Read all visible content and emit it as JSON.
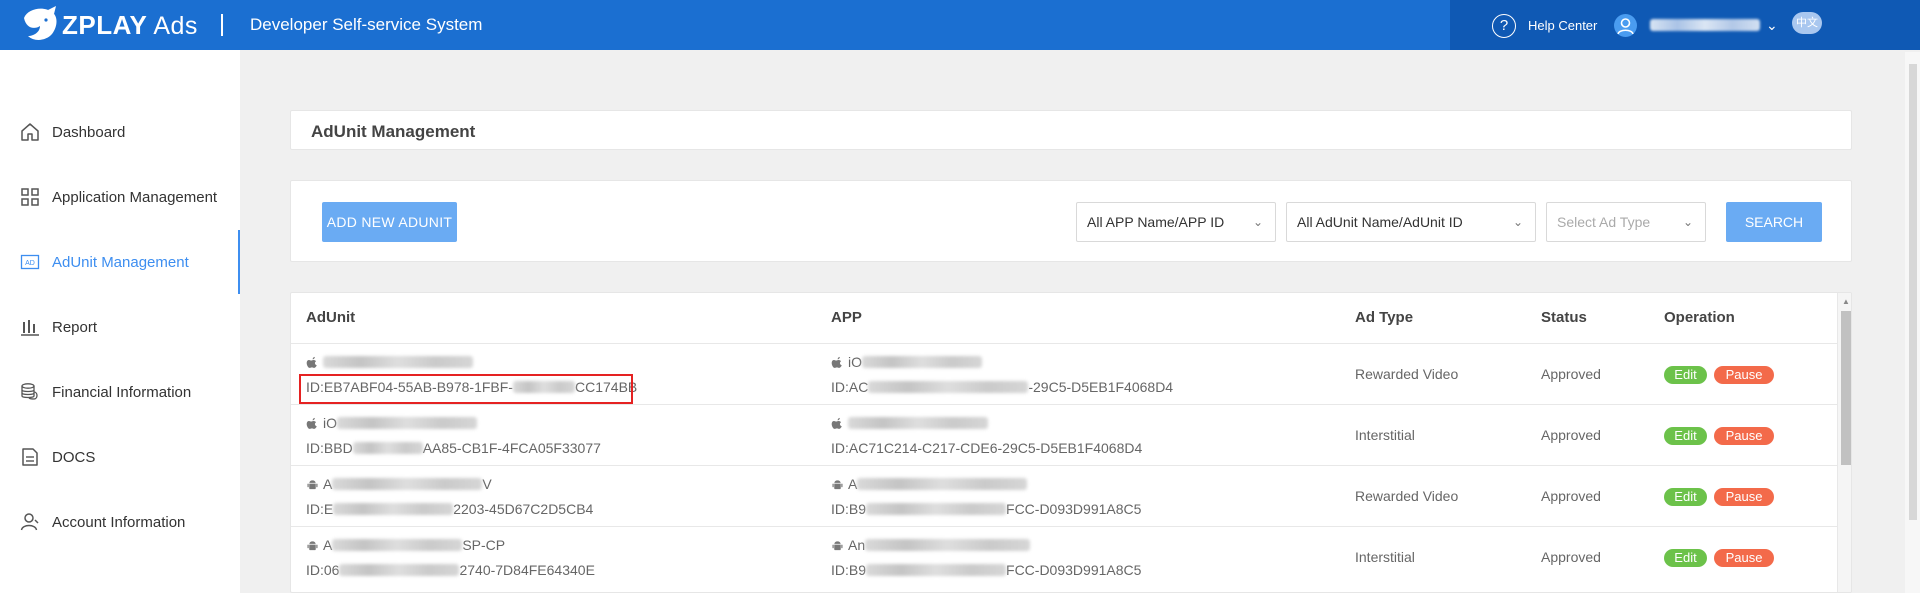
{
  "header": {
    "brand": "ZPLAY",
    "brand_suffix": "Ads",
    "system_title": "Developer Self-service System",
    "help_label": "Help Center",
    "language_badge": "中文",
    "colors": {
      "bar": "#1b6fd1",
      "bar_right": "#0f59b4"
    }
  },
  "sidebar": {
    "items": [
      {
        "label": "Dashboard",
        "icon": "home-icon"
      },
      {
        "label": "Application Management",
        "icon": "grid-icon"
      },
      {
        "label": "AdUnit Management",
        "icon": "ad-icon",
        "active": true
      },
      {
        "label": "Report",
        "icon": "bar-chart-icon"
      },
      {
        "label": "Financial Information",
        "icon": "coins-icon"
      },
      {
        "label": "DOCS",
        "icon": "document-icon"
      },
      {
        "label": "Account Information",
        "icon": "user-icon"
      }
    ],
    "active_color": "#3d8ef0"
  },
  "page": {
    "title": "AdUnit Management"
  },
  "toolbar": {
    "add_label": "ADD NEW ADUNIT",
    "app_filter": "All APP Name/APP ID",
    "adunit_filter": "All AdUnit Name/AdUnit ID",
    "adtype_placeholder": "Select Ad Type",
    "search_label": "SEARCH"
  },
  "table": {
    "headers": [
      "AdUnit",
      "APP",
      "Ad Type",
      "Status",
      "Operation"
    ],
    "rows": [
      {
        "adunit_os": "ios",
        "adunit_name": "",
        "adunit_id_a": "ID:EB7ABF04-55AB-B978-1FBF-",
        "adunit_id_b": "CC174BB",
        "app_os": "ios",
        "app_name": "iO",
        "app_id_a": "ID:AC",
        "app_id_b": "-29C5-D5EB1F4068D4",
        "ad_type": "Rewarded Video",
        "status": "Approved",
        "edit": "Edit",
        "pause": "Pause"
      },
      {
        "adunit_os": "ios",
        "adunit_name": "iO",
        "adunit_id_a": "ID:BBD",
        "adunit_id_b": "AA85-CB1F-4FCA05F33077",
        "app_os": "ios",
        "app_name": "",
        "app_id_a": "ID:AC71C214-C217-CDE6-29C5-D5EB1F4068D4",
        "app_id_b": "",
        "ad_type": "Interstitial",
        "status": "Approved",
        "edit": "Edit",
        "pause": "Pause"
      },
      {
        "adunit_os": "android",
        "adunit_name": "A",
        "adunit_name_tail": "V",
        "adunit_id_a": "ID:E",
        "adunit_id_b": "2203-45D67C2D5CB4",
        "app_os": "android",
        "app_name": "A",
        "app_id_a": "ID:B9",
        "app_id_b": "FCC-D093D991A8C5",
        "ad_type": "Rewarded Video",
        "status": "Approved",
        "edit": "Edit",
        "pause": "Pause"
      },
      {
        "adunit_os": "android",
        "adunit_name": "A",
        "adunit_name_tail": "SP-CP",
        "adunit_id_a": "ID:06",
        "adunit_id_b": "2740-7D84FE64340E",
        "app_os": "android",
        "app_name": "An",
        "app_id_a": "ID:B9",
        "app_id_b": "FCC-D093D991A8C5",
        "ad_type": "Interstitial",
        "status": "Approved",
        "edit": "Edit",
        "pause": "Pause"
      }
    ],
    "tag_colors": {
      "edit": "#6cc24a",
      "pause": "#f36a4a"
    }
  }
}
